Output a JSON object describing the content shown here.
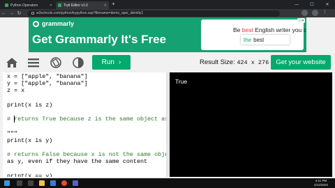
{
  "browser": {
    "tabs": [
      {
        "label": "Python Operators"
      },
      {
        "label": "Tryit Editor v1.0"
      }
    ],
    "url": "w3schools.com/python/trypython.asp?filename=demo_oper_identity1"
  },
  "ad": {
    "brand": "grammarly",
    "headline": "Get Grammarly It's Free",
    "card_pre": "Be ",
    "card_highlight": "best",
    "card_post": " English writer you can be!",
    "chip_the": "the",
    "chip_best": "best"
  },
  "toolbar": {
    "run_label": "Run",
    "result_size_label": "Result Size:",
    "result_size_value": "424 x 276",
    "get_website_label": "Get your website"
  },
  "editor": {
    "code_lines": [
      "x = [\"apple\", \"banana\"]",
      "y = [\"apple\", \"banana\"]",
      "z = x",
      "",
      "print(x is z)",
      "",
      "# returns True because z is the same object as x",
      "",
      "\"\"\"",
      "print(x is y)",
      "",
      "# returns False because x is not the same object",
      "as y, even if they have the same content",
      "",
      "print(x == y)"
    ]
  },
  "result": {
    "output": "True"
  },
  "taskbar": {
    "time": "4:11 PM",
    "date": "2/12/2022"
  },
  "colors": {
    "accent": "#04aa6d",
    "ad_bg": "#15a172",
    "comment": "#2c7a2c"
  }
}
